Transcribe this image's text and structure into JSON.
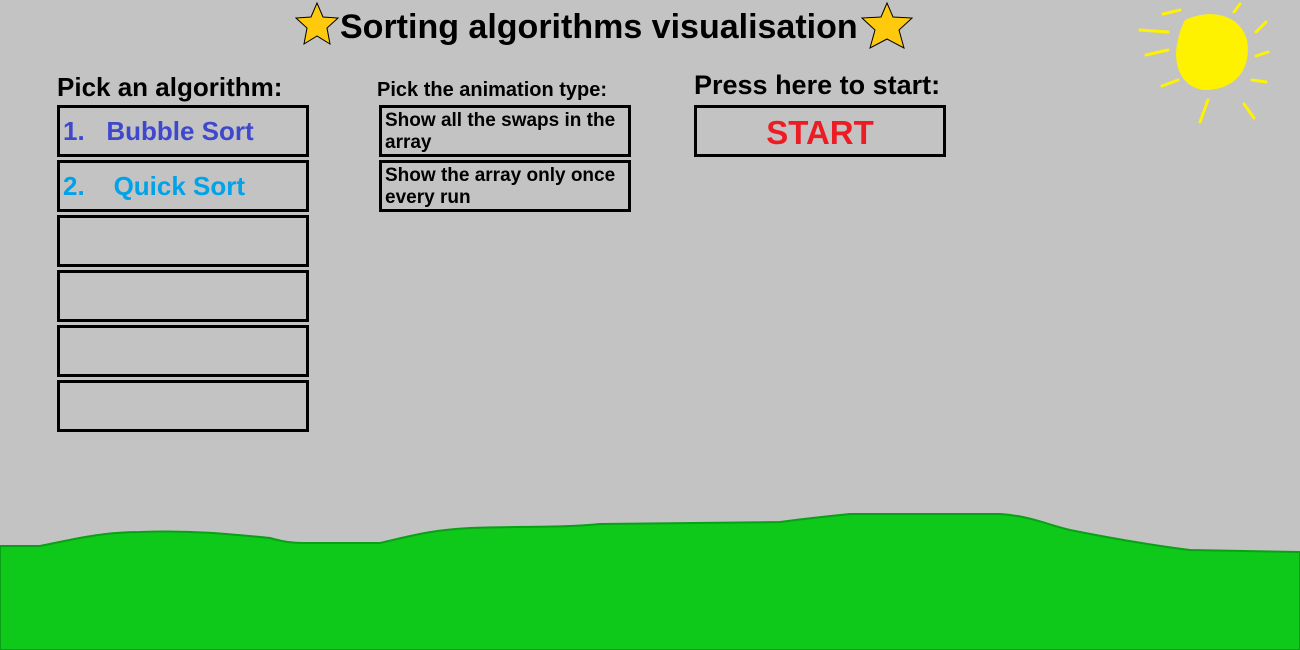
{
  "title": "Sorting algorithms visualisation",
  "algorithm_section": {
    "heading": "Pick an algorithm:",
    "items": [
      {
        "label": "1.   Bubble Sort",
        "color": "#3f48cc"
      },
      {
        "label": "2.    Quick Sort",
        "color": "#00a2e8"
      },
      {
        "label": ""
      },
      {
        "label": ""
      },
      {
        "label": ""
      },
      {
        "label": ""
      }
    ]
  },
  "animation_section": {
    "heading": "Pick the animation type:",
    "options": [
      {
        "label": "Show all the swaps in the array"
      },
      {
        "label": "Show the array only once every run"
      }
    ]
  },
  "start_section": {
    "heading": "Press here to start:",
    "button_label": "START",
    "button_color": "#ed1c24"
  },
  "colors": {
    "background": "#c3c3c3",
    "grass": "#0ec81a",
    "sun": "#fff200",
    "star": "#ffc90e"
  },
  "icons": [
    "star-icon",
    "sun-icon",
    "grass-hills"
  ]
}
